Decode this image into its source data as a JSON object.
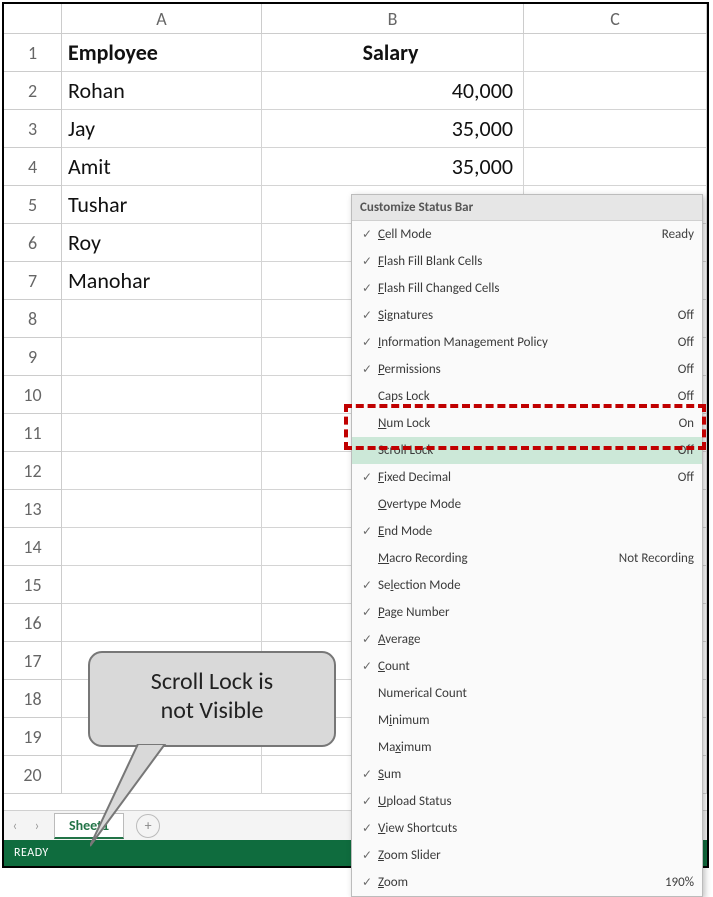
{
  "columns": [
    "A",
    "B",
    "C"
  ],
  "headers": {
    "A": "Employee",
    "B": "Salary"
  },
  "rows": [
    {
      "n": "1",
      "A": "Employee",
      "B": "Salary",
      "header": true
    },
    {
      "n": "2",
      "A": "Rohan",
      "B": "40,000"
    },
    {
      "n": "3",
      "A": "Jay",
      "B": "35,000"
    },
    {
      "n": "4",
      "A": "Amit",
      "B": "35,000"
    },
    {
      "n": "5",
      "A": "Tushar",
      "B": ""
    },
    {
      "n": "6",
      "A": "Roy",
      "B": ""
    },
    {
      "n": "7",
      "A": "Manohar",
      "B": ""
    },
    {
      "n": "8"
    },
    {
      "n": "9"
    },
    {
      "n": "10"
    },
    {
      "n": "11"
    },
    {
      "n": "12"
    },
    {
      "n": "13"
    },
    {
      "n": "14"
    },
    {
      "n": "15"
    },
    {
      "n": "16"
    },
    {
      "n": "17"
    },
    {
      "n": "18"
    },
    {
      "n": "19"
    },
    {
      "n": "20"
    }
  ],
  "sheet_tab": "Sheet1",
  "status_text": "READY",
  "context_menu": {
    "title": "Customize Status Bar",
    "items": [
      {
        "checked": true,
        "label": "Cell Mode",
        "underline": 0,
        "value": "Ready"
      },
      {
        "checked": true,
        "label": "Flash Fill Blank Cells",
        "underline": 0
      },
      {
        "checked": true,
        "label": "Flash Fill Changed Cells",
        "underline": 0
      },
      {
        "checked": true,
        "label": "Signatures",
        "underline": 0,
        "value": "Off"
      },
      {
        "checked": true,
        "label": "Information Management Policy",
        "underline": 0,
        "value": "Off"
      },
      {
        "checked": true,
        "label": "Permissions",
        "underline": 0,
        "value": "Off"
      },
      {
        "checked": false,
        "label": "Caps Lock",
        "value": "Off"
      },
      {
        "checked": false,
        "label": "Num Lock",
        "underline": 0,
        "value": "On"
      },
      {
        "checked": false,
        "label": "Scroll Lock",
        "value": "Off",
        "highlight": true
      },
      {
        "checked": true,
        "label": "Fixed Decimal",
        "underline": 0,
        "value": "Off"
      },
      {
        "checked": false,
        "label": "Overtype Mode",
        "underline": 0
      },
      {
        "checked": true,
        "label": "End Mode",
        "underline": 0
      },
      {
        "checked": false,
        "label": "Macro Recording",
        "underline": 0,
        "value": "Not Recording"
      },
      {
        "checked": true,
        "label": "Selection Mode",
        "underline": 2
      },
      {
        "checked": true,
        "label": "Page Number",
        "underline": 0
      },
      {
        "checked": true,
        "label": "Average",
        "underline": 0
      },
      {
        "checked": true,
        "label": "Count",
        "underline": 0
      },
      {
        "checked": false,
        "label": "Numerical Count"
      },
      {
        "checked": false,
        "label": "Minimum",
        "underline": 1
      },
      {
        "checked": false,
        "label": "Maximum",
        "underline": 2
      },
      {
        "checked": true,
        "label": "Sum",
        "underline": 0
      },
      {
        "checked": true,
        "label": "Upload Status",
        "underline": 0
      },
      {
        "checked": true,
        "label": "View Shortcuts",
        "underline": 0
      },
      {
        "checked": true,
        "label": "Zoom Slider",
        "underline": 0
      },
      {
        "checked": true,
        "label": "Zoom",
        "underline": 0,
        "value": "190%"
      }
    ]
  },
  "callout_line1": "Scroll Lock is",
  "callout_line2": "not Visible",
  "nav_prev": "‹",
  "nav_next": "›",
  "add_sheet": "+",
  "checkmark": "✓"
}
